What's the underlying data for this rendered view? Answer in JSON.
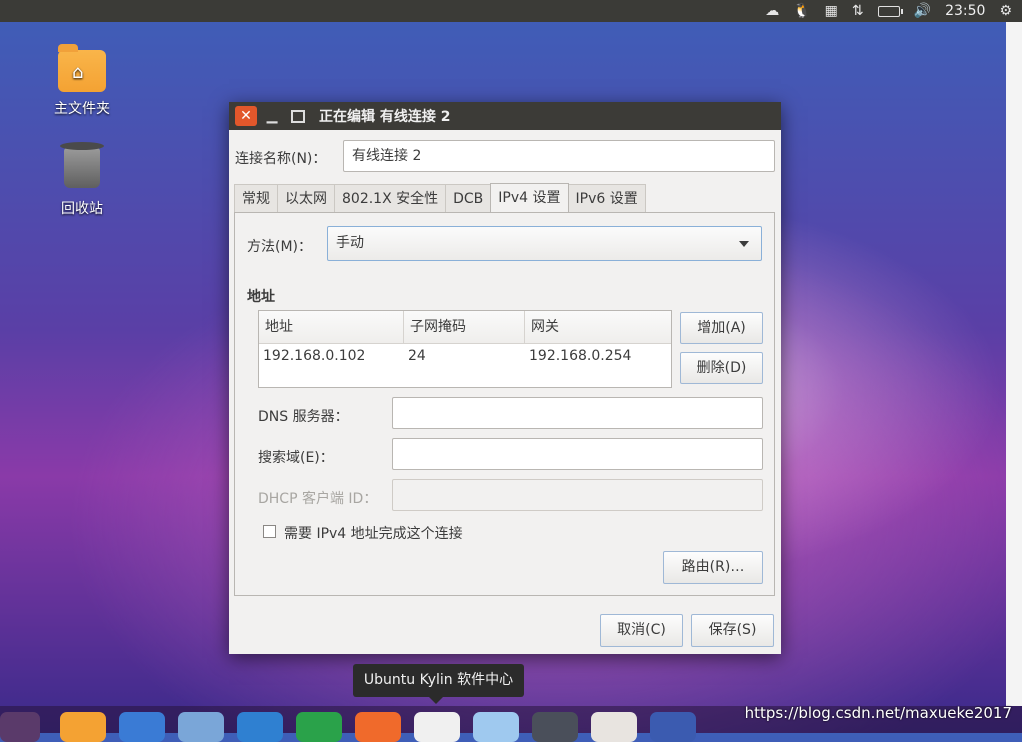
{
  "topbar": {
    "tray_icons": [
      "weather-icon",
      "tux-icon",
      "calendar-icon",
      "network-arrows-icon",
      "battery-icon",
      "volume-icon"
    ],
    "clock": "23:50",
    "settings_icon": "gear-icon"
  },
  "desktop": {
    "icons": [
      {
        "label": "主文件夹",
        "icon": "home-folder-icon"
      },
      {
        "label": "回收站",
        "icon": "trash-icon"
      }
    ]
  },
  "dialog": {
    "title": "正在编辑 有线连接 2",
    "connection_name_label": "连接名称(N)：",
    "connection_name_value": "有线连接 2",
    "tabs": [
      "常规",
      "以太网",
      "802.1X 安全性",
      "DCB",
      "IPv4 设置",
      "IPv6 设置"
    ],
    "active_tab": "IPv4 设置",
    "method_label": "方法(M)：",
    "method_value": "手动",
    "address_section": "地址",
    "table": {
      "headers": [
        "地址",
        "子网掩码",
        "网关"
      ],
      "rows": [
        [
          "192.168.0.102",
          "24",
          "192.168.0.254"
        ]
      ]
    },
    "add_button": "增加(A)",
    "delete_button": "删除(D)",
    "dns_label": "DNS 服务器：",
    "dns_value": "",
    "search_domain_label": "搜索域(E)：",
    "search_domain_value": "",
    "dhcp_label": "DHCP 客户端 ID：",
    "dhcp_value": "",
    "require_ipv4_label": "需要 IPv4 地址完成这个连接",
    "require_ipv4_checked": false,
    "routes_button": "路由(R)…",
    "cancel_button": "取消(C)",
    "save_button": "保存(S)"
  },
  "dock": {
    "tooltip": "Ubuntu Kylin 软件中心"
  },
  "watermark": "https://blog.csdn.net/maxueke2017",
  "colors": {
    "close_button": "#e2572b",
    "titlebar": "#3c3b37",
    "focus_border": "#8ab0d8"
  }
}
